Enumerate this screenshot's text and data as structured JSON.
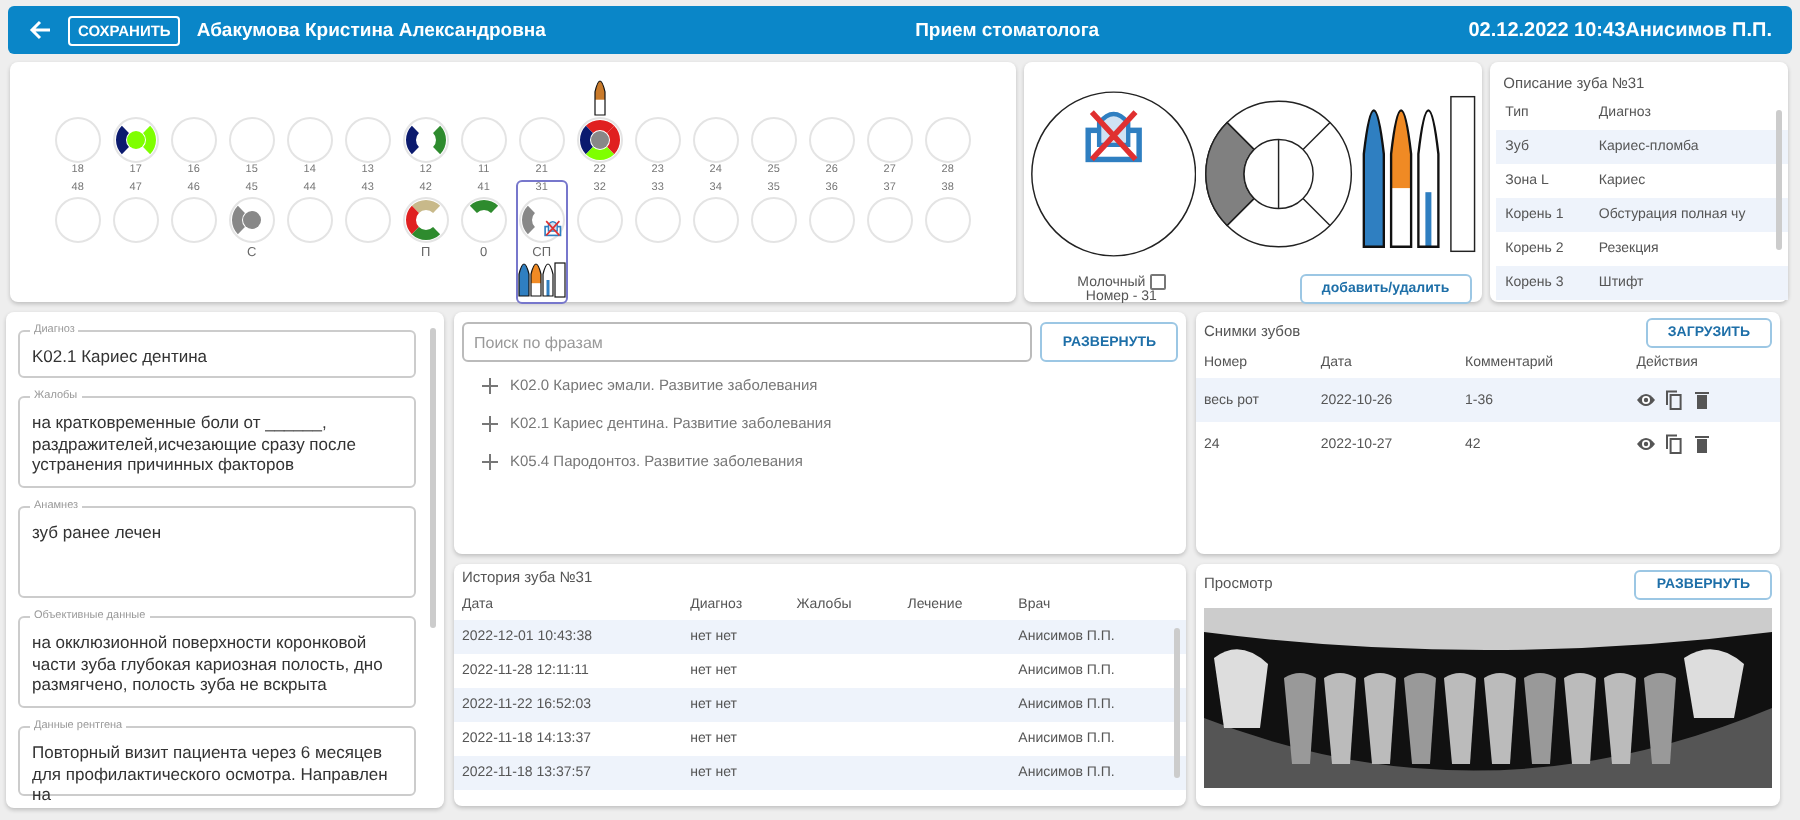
{
  "header": {
    "save_button": "СОХРАНИТЬ",
    "patient": "Абакумова Кристина Александровна",
    "title": "Прием стоматолога",
    "right_text": "02.12.2022 10:43Анисимов П.П."
  },
  "chart": {
    "upper": [
      {
        "number": "18",
        "selected": false,
        "extracted": false,
        "implant": false
      },
      {
        "number": "17",
        "selected": false,
        "extracted": false,
        "implant": false,
        "marks": [
          {
            "kind": "left",
            "color": "#0b1a6e"
          },
          {
            "kind": "right",
            "color": "#7fff00"
          },
          {
            "kind": "center",
            "color": "#7fff00"
          }
        ]
      },
      {
        "number": "16",
        "selected": false,
        "extracted": false,
        "implant": false
      },
      {
        "number": "15",
        "selected": false,
        "extracted": false,
        "implant": false
      },
      {
        "number": "14",
        "selected": false,
        "extracted": false,
        "implant": false
      },
      {
        "number": "13",
        "selected": false,
        "extracted": false,
        "implant": false
      },
      {
        "number": "12",
        "selected": false,
        "extracted": false,
        "implant": false,
        "marks": [
          {
            "kind": "left",
            "color": "#0b1a6e"
          },
          {
            "kind": "right",
            "color": "#2e8b2e"
          }
        ]
      },
      {
        "number": "11",
        "selected": false,
        "extracted": false,
        "implant": false
      },
      {
        "number": "21",
        "selected": false,
        "extracted": false,
        "implant": false
      },
      {
        "number": "22",
        "selected": false,
        "extracted": false,
        "implant": true,
        "marks": [
          {
            "kind": "top",
            "color": "#e02020"
          },
          {
            "kind": "right",
            "color": "#e02020"
          },
          {
            "kind": "left",
            "color": "#0b1a6e"
          },
          {
            "kind": "center",
            "color": "#888888"
          },
          {
            "kind": "bottom",
            "color": "#7fff00"
          }
        ]
      },
      {
        "number": "23",
        "selected": false,
        "extracted": false,
        "implant": false
      },
      {
        "number": "24",
        "selected": false,
        "extracted": false,
        "implant": false
      },
      {
        "number": "25",
        "selected": false,
        "extracted": false,
        "implant": false
      },
      {
        "number": "26",
        "selected": false,
        "extracted": false,
        "implant": false
      },
      {
        "number": "27",
        "selected": false,
        "extracted": false,
        "implant": false
      },
      {
        "number": "28",
        "selected": false,
        "extracted": false,
        "implant": false
      }
    ],
    "lower": [
      {
        "number": "48",
        "selected": false,
        "extracted": false
      },
      {
        "number": "47",
        "selected": false,
        "extracted": false
      },
      {
        "number": "46",
        "selected": false,
        "extracted": false
      },
      {
        "number": "45",
        "selected": false,
        "extracted": false,
        "marks": [
          {
            "kind": "left",
            "color": "#888888"
          },
          {
            "kind": "center",
            "color": "#888888"
          }
        ],
        "label": "С"
      },
      {
        "number": "44",
        "selected": false,
        "extracted": false
      },
      {
        "number": "43",
        "selected": false,
        "extracted": false
      },
      {
        "number": "42",
        "selected": false,
        "extracted": false,
        "marks": [
          {
            "kind": "top",
            "color": "#c8b98a"
          },
          {
            "kind": "left",
            "color": "#e02020"
          },
          {
            "kind": "bottom",
            "color": "#2e8b2e"
          }
        ],
        "label": "П"
      },
      {
        "number": "41",
        "selected": false,
        "extracted": false,
        "roots": {
          "kind": "slots"
        },
        "marks": [
          {
            "kind": "top",
            "color": "#2e8b2e"
          }
        ],
        "label": "0"
      },
      {
        "number": "31",
        "selected": true,
        "extracted": true,
        "roots": {
          "kind": "treated"
        },
        "marks": [
          {
            "kind": "left",
            "color": "#888888"
          }
        ],
        "label": "СП"
      },
      {
        "number": "32",
        "selected": false,
        "extracted": false
      },
      {
        "number": "33",
        "selected": false,
        "extracted": false
      },
      {
        "number": "34",
        "selected": false,
        "extracted": false
      },
      {
        "number": "35",
        "selected": false,
        "extracted": false
      },
      {
        "number": "36",
        "selected": false,
        "extracted": false
      },
      {
        "number": "37",
        "selected": false,
        "extracted": false
      },
      {
        "number": "38",
        "selected": false,
        "extracted": false
      }
    ]
  },
  "detail": {
    "extracted": true,
    "ring": [
      {
        "kind": "left",
        "color": "#808080"
      }
    ],
    "roots": [
      {
        "kind": "fill",
        "color": "#2f7fc1",
        "level": 1
      },
      {
        "kind": "fill",
        "color": "#f08a24",
        "level": 0.57
      },
      {
        "kind": "canal",
        "color": "#2f7fc1",
        "level": 0.4
      }
    ],
    "milk_label": "Молочный",
    "milk_checked": false,
    "number_text": "Номер - 31",
    "button": "добавить/удалить"
  },
  "description": {
    "title": "Описание зуба №31",
    "columns": [
      "Тип",
      "Диагноз"
    ],
    "rows": [
      [
        "Зуб",
        "Кариес-пломба"
      ],
      [
        "Зона L",
        "Кариес"
      ],
      [
        "Корень 1",
        "Обстурация полная чу"
      ],
      [
        "Корень 2",
        "Резекция"
      ],
      [
        "Корень 3",
        "Штифт"
      ]
    ]
  },
  "fields": [
    {
      "label": "Диагноз",
      "value": "K02.1 Кариес дентина"
    },
    {
      "label": "Жалобы",
      "value": "на кратковременные боли от ______, раздражителей,исчезающие сразу после устранения причинных факторов"
    },
    {
      "label": "Анамнез",
      "value": "зуб ранее лечен"
    },
    {
      "label": "Объективные данные",
      "value": "на окклюзионной поверхности коронковой части зуба глубокая кариозная полость, дно размягчено, полость зуба не вскрыта"
    },
    {
      "label": "Данные рентгена",
      "value": "Повторный визит пациента через 6 месяцев для профилактического осмотра. Направлен на"
    }
  ],
  "search": {
    "placeholder": "Поиск по фразам",
    "button": "РАЗВЕРНУТЬ",
    "phrases": [
      "K02.0 Кариес эмали. Развитие заболевания",
      "K02.1 Кариес дентина. Развитие заболевания",
      "K05.4 Пародонтоз. Развитие заболевания"
    ]
  },
  "history": {
    "title": "История зуба №31",
    "columns": [
      "Дата",
      "Диагноз",
      "Жалобы",
      "Лечение",
      "Врач"
    ],
    "rows": [
      {
        "date": "2022-12-01 10:43:38",
        "diagnosis": "нет нет",
        "doctor": "Анисимов П.П."
      },
      {
        "date": "2022-11-28 12:11:11",
        "diagnosis": "нет нет",
        "doctor": "Анисимов П.П."
      },
      {
        "date": "2022-11-22 16:52:03",
        "diagnosis": "нет нет",
        "doctor": "Анисимов П.П."
      },
      {
        "date": "2022-11-18 14:13:37",
        "diagnosis": "нет нет",
        "doctor": "Анисимов П.П."
      },
      {
        "date": "2022-11-18 13:37:57",
        "diagnosis": "нет нет",
        "doctor": "Анисимов П.П."
      }
    ]
  },
  "images": {
    "title": "Снимки зубов",
    "button": "ЗАГРУЗИТЬ",
    "columns": [
      "Номер",
      "Дата",
      "Комментарий",
      "Действия"
    ],
    "rows": [
      {
        "number": "весь рот",
        "date": "2022-10-26",
        "comment": "1-36"
      },
      {
        "number": "24",
        "date": "2022-10-27",
        "comment": "42"
      }
    ]
  },
  "preview": {
    "title": "Просмотр",
    "button": "РАЗВЕРНУТЬ"
  }
}
